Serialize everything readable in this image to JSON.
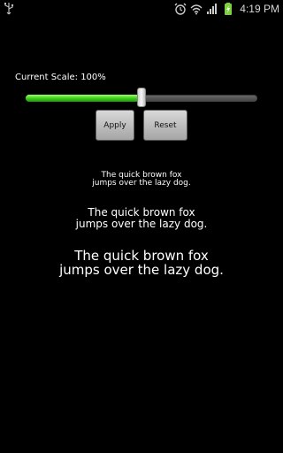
{
  "status_bar": {
    "time": "4:19 PM",
    "icons": [
      "usb-icon",
      "alarm-icon",
      "wifi-icon",
      "signal-icon",
      "battery-charging-icon"
    ],
    "battery_color": "#7bd13b"
  },
  "scale": {
    "label": "Current Scale: 100%",
    "slider_fraction": 0.5
  },
  "buttons": {
    "apply_label": "Apply",
    "reset_label": "Reset"
  },
  "samples": [
    {
      "line1": "The quick brown fox",
      "line2": "jumps over the lazy dog."
    },
    {
      "line1": "The quick brown fox",
      "line2": "jumps over the lazy dog."
    },
    {
      "line1": "The quick brown fox",
      "line2": "jumps over the lazy dog."
    }
  ],
  "colors": {
    "accent_green": "#3fd11c",
    "background": "#000000"
  }
}
